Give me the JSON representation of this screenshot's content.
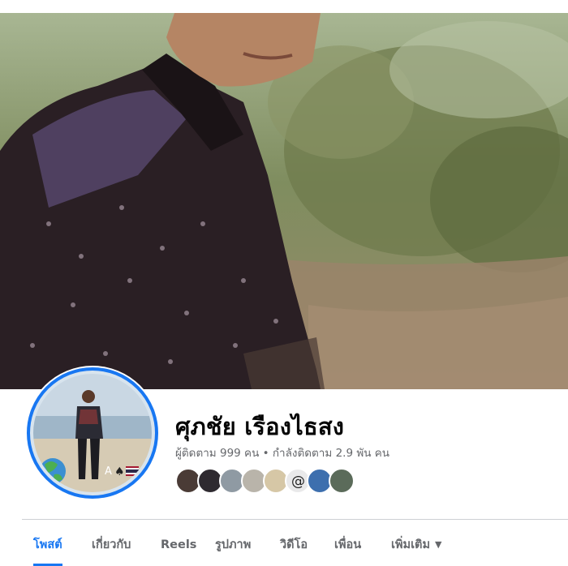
{
  "profile": {
    "name": "ศุภชัย เรืองไธสง",
    "followers": "ผู้ติดตาม 999 คน",
    "separator": "•",
    "following": "กำลังติดตาม 2.9 พัน คน"
  },
  "friends_count_shown": 8,
  "tabs": [
    {
      "label": "โพสต์",
      "active": true
    },
    {
      "label": "เกี่ยวกับ",
      "active": false
    },
    {
      "label": "Reels",
      "active": false
    },
    {
      "label": "รูปภาพ",
      "active": false
    },
    {
      "label": "วิดีโอ",
      "active": false
    },
    {
      "label": "เพื่อน",
      "active": false
    },
    {
      "label": "เพิ่มเติม",
      "active": false
    }
  ],
  "colors": {
    "accent": "#1877f2",
    "text_primary": "#050505",
    "text_secondary": "#65676b"
  }
}
